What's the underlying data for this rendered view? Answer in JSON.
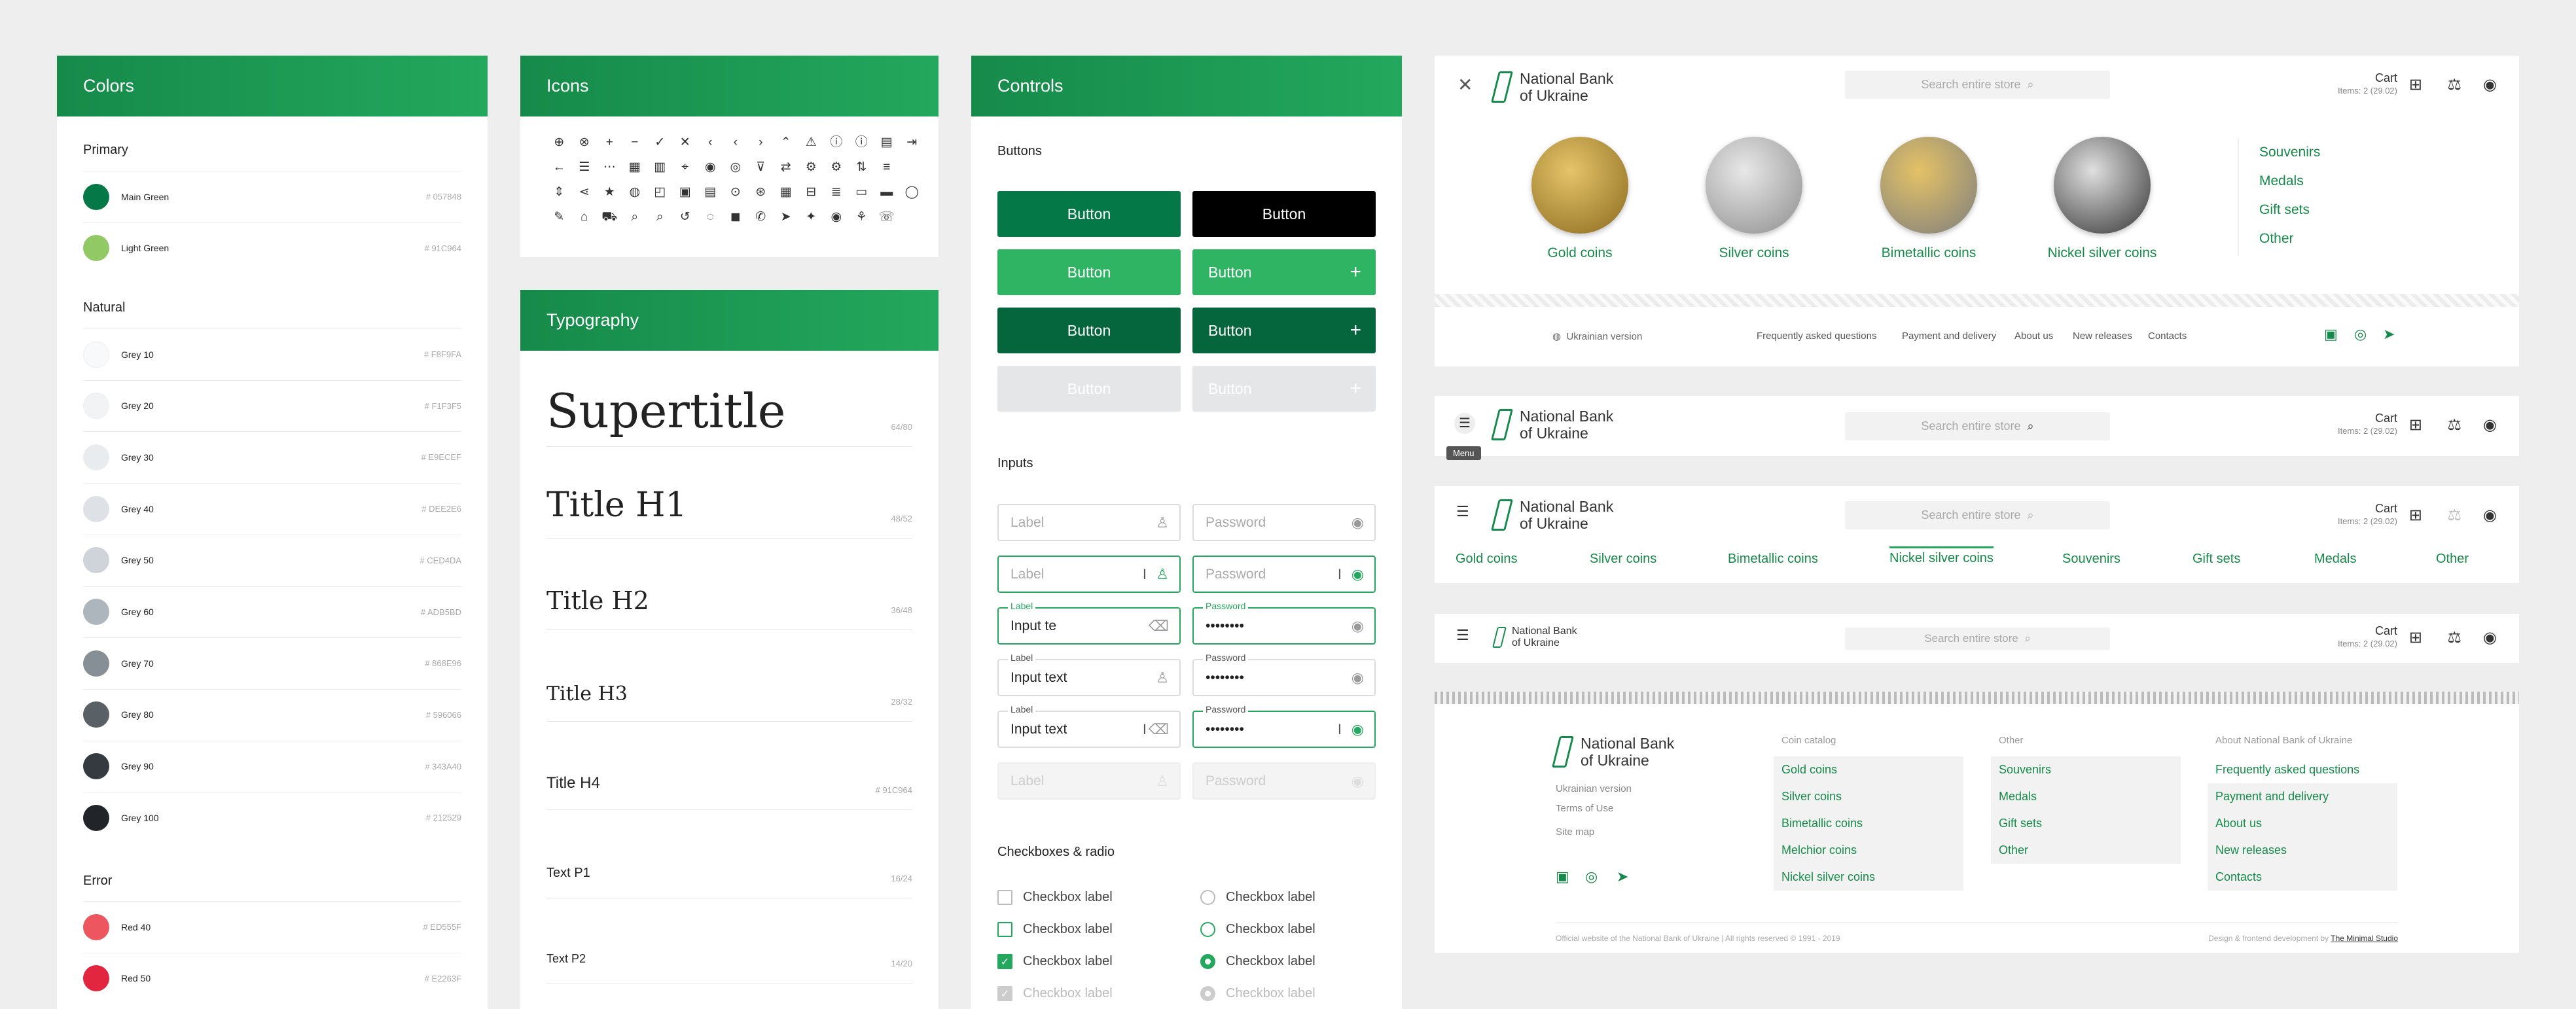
{
  "colors": {
    "title": "Colors",
    "primary_label": "Primary",
    "natural_label": "Natural",
    "error_label": "Error",
    "primary": [
      {
        "name": "Main Green",
        "hex": "# 057848",
        "color": "#057848"
      },
      {
        "name": "Light Green",
        "hex": "# 91C964",
        "color": "#91C964"
      }
    ],
    "natural": [
      {
        "name": "Grey 10",
        "hex": "# F8F9FA",
        "color": "#F8F9FA"
      },
      {
        "name": "Grey 20",
        "hex": "# F1F3F5",
        "color": "#F1F3F5"
      },
      {
        "name": "Grey 30",
        "hex": "# E9ECEF",
        "color": "#E9ECEF"
      },
      {
        "name": "Grey 40",
        "hex": "# DEE2E6",
        "color": "#DEE2E6"
      },
      {
        "name": "Grey 50",
        "hex": "# CED4DA",
        "color": "#CED4DA"
      },
      {
        "name": "Grey 60",
        "hex": "# ADB5BD",
        "color": "#ADB5BD"
      },
      {
        "name": "Grey 70",
        "hex": "# 868E96",
        "color": "#868E96"
      },
      {
        "name": "Grey 80",
        "hex": "# 596066",
        "color": "#596066"
      },
      {
        "name": "Grey 90",
        "hex": "# 343A40",
        "color": "#343A40"
      },
      {
        "name": "Grey 100",
        "hex": "# 212529",
        "color": "#212529"
      }
    ],
    "error": [
      {
        "name": "Red 40",
        "hex": "# ED555F",
        "color": "#ED555F"
      },
      {
        "name": "Red 50",
        "hex": "# E2263F",
        "color": "#E2263F"
      }
    ]
  },
  "icons": {
    "title": "Icons",
    "glyphs": [
      "⊕",
      "⊗",
      "+",
      "−",
      "✓",
      "✕",
      "‹",
      "‹",
      "›",
      "⌃",
      "⚠",
      "ⓘ",
      "ⓘ",
      "▤",
      "⇥",
      "",
      "",
      "",
      "←",
      "☰",
      "⋯",
      "▦",
      "▥",
      "⌖",
      "◉",
      "◎",
      "⊽",
      "⇄",
      "⚙",
      "⚙",
      "⇅",
      "≡",
      "",
      "",
      "",
      "",
      "⇕",
      "⋖",
      "★",
      "◍",
      "◰",
      "▣",
      "▤",
      "⊙",
      "⊛",
      "▦",
      "⊟",
      "≣",
      "▭",
      "▬",
      "◯",
      "",
      "",
      "",
      "✎",
      "⌂",
      "⛟",
      "⌕",
      "⌕",
      "↺",
      "◌",
      "◼",
      "✆",
      "➤",
      "✦",
      "◉",
      "⚘",
      "☏",
      "",
      "",
      "",
      ""
    ]
  },
  "typography": {
    "title": "Typography",
    "rows": [
      {
        "label": "Supertitle",
        "size": "64/80"
      },
      {
        "label": "Title H1",
        "size": "48/52"
      },
      {
        "label": "Title H2",
        "size": "36/48"
      },
      {
        "label": "Title H3",
        "size": "28/32"
      },
      {
        "label": "Title H4",
        "size": "# 91C964"
      },
      {
        "label": "Text P1",
        "size": "16/24"
      },
      {
        "label": "Text P2",
        "size": "14/20"
      }
    ]
  },
  "controls": {
    "title": "Controls",
    "buttons_label": "Buttons",
    "inputs_label": "Inputs",
    "checks_label": "Checkboxes & radio",
    "button_text": "Button",
    "plus": "+",
    "inputs": {
      "label": "Label",
      "password": "Password",
      "input_typing": "Input te",
      "input_text": "Input text",
      "dots": "••••••••"
    },
    "checkbox_label": "Checkbox label"
  },
  "site": {
    "logo": [
      "National Bank",
      "of Ukraine"
    ],
    "search_placeholder": "Search entire store",
    "cart_label": "Cart",
    "cart_items": "Items: 2 (29.02)",
    "menu_tooltip": "Menu",
    "coins": [
      {
        "label": "Gold coins",
        "color1": "#e6c46a",
        "color2": "#8a6a1e"
      },
      {
        "label": "Silver coins",
        "color1": "#e8e8e8",
        "color2": "#8d8d8d"
      },
      {
        "label": "Bimetallic coins",
        "color1": "#e4c266",
        "color2": "#7e7e7e"
      },
      {
        "label": "Nickel silver coins",
        "color1": "#e0e0e0",
        "color2": "#333333"
      }
    ],
    "side_links": [
      "Souvenirs",
      "Medals",
      "Gift sets",
      "Other"
    ],
    "footer_nav": [
      "Ukrainian version",
      "Frequently asked questions",
      "Payment and delivery",
      "About us",
      "New releases",
      "Contacts"
    ],
    "tabs": [
      "Gold coins",
      "Silver coins",
      "Bimetallic coins",
      "Nickel silver coins",
      "Souvenirs",
      "Gift sets",
      "Medals",
      "Other"
    ],
    "footer": {
      "left_links": [
        "Ukrainian version",
        "Terms of Use",
        "Site map"
      ],
      "col1_title": "Coin catalog",
      "col1": [
        "Gold coins",
        "Silver coins",
        "Bimetallic coins",
        "Melchior coins",
        "Nickel silver coins"
      ],
      "col2_title": "Other",
      "col2": [
        "Souvenirs",
        "Medals",
        "Gift sets",
        "Other"
      ],
      "col3_title": "About National Bank of Ukraine",
      "col3": [
        "Frequently asked questions",
        "Payment and delivery",
        "About us",
        "New releases",
        "Contacts"
      ],
      "copyright": "Official website of the National Bank of Ukraine | All rights reserved © 1991 - 2019",
      "credit": "Design & frontend development by ",
      "studio": "The Minimal Studio"
    }
  }
}
